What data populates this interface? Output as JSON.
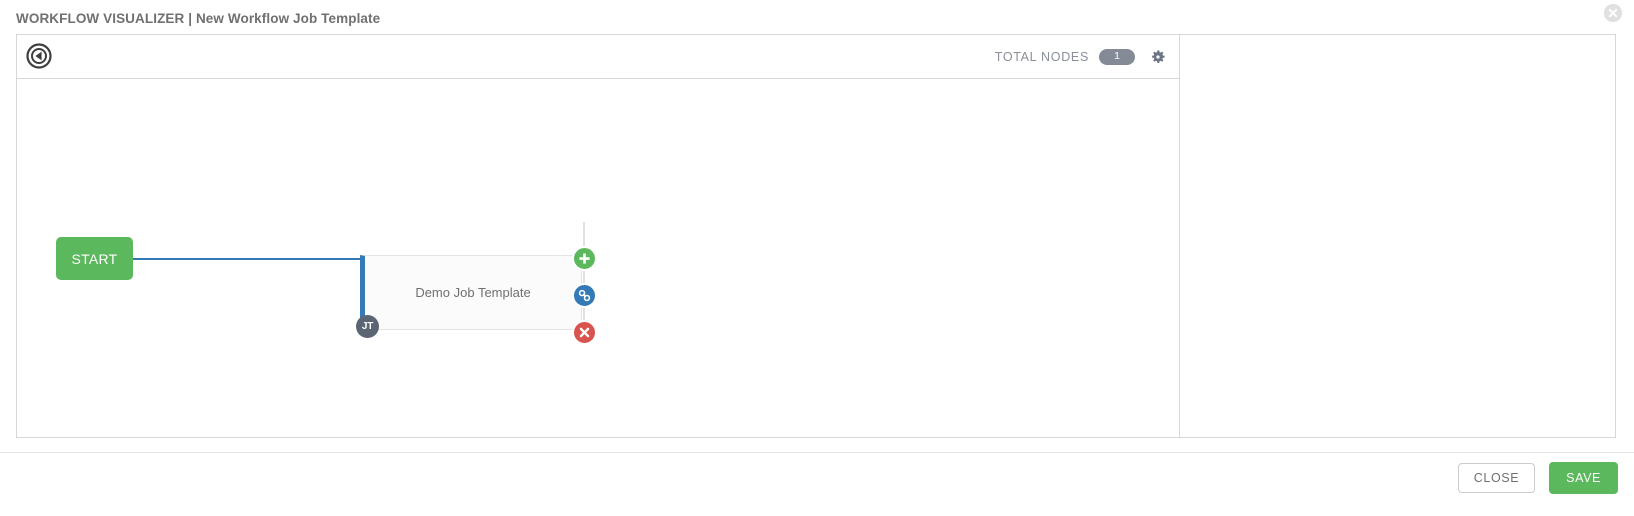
{
  "header": {
    "title": "WORKFLOW VISUALIZER | New Workflow Job Template",
    "close_icon": "close-icon"
  },
  "canvas_toolbar": {
    "compass_icon": "compass-icon",
    "total_nodes_label": "TOTAL NODES",
    "total_nodes_count": "1",
    "settings_icon": "gear-icon"
  },
  "workflow": {
    "start_node": {
      "label": "START"
    },
    "job_node": {
      "label": "Demo Job Template",
      "type_badge": "JT",
      "accent_color": "#337ab7"
    },
    "actions": [
      {
        "name": "add-node",
        "icon": "plus-icon",
        "color": "#5cb85c"
      },
      {
        "name": "link-node",
        "icon": "link-icon",
        "color": "#337ab7"
      },
      {
        "name": "delete-node",
        "icon": "close-x-icon",
        "color": "#d9534f"
      }
    ],
    "link_color": "#337ab7"
  },
  "footer": {
    "close_label": "CLOSE",
    "save_label": "SAVE"
  },
  "colors": {
    "green": "#5cb85c",
    "blue": "#337ab7",
    "red": "#d9534f",
    "badge_gray": "#848b96"
  }
}
